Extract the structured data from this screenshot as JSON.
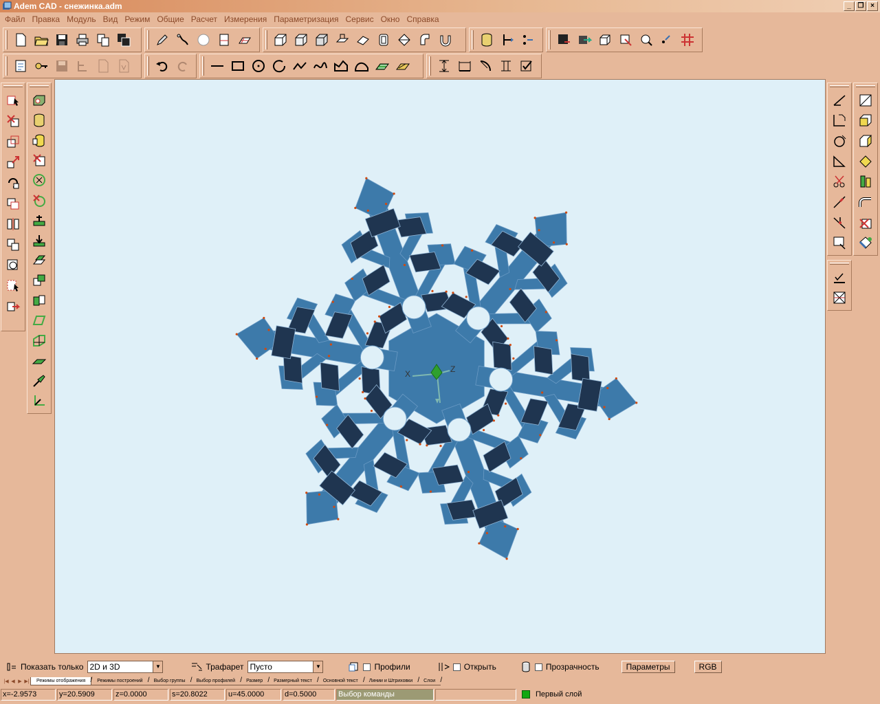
{
  "window": {
    "title": "Adem CAD - снежинка.adm",
    "controls": [
      "_",
      "❐",
      "×"
    ]
  },
  "menu": [
    "Файл",
    "Правка",
    "Модуль",
    "Вид",
    "Режим",
    "Общие",
    "Расчет",
    "Измерения",
    "Параметризация",
    "Сервис",
    "Окно",
    "Справка"
  ],
  "toolbars": {
    "top1": [
      "new-file-icon",
      "open-folder-icon",
      "save-icon",
      "print-icon",
      "copy-files-icon",
      "save-all-icon",
      "pencil-icon",
      "sweep-icon",
      "sphere-icon",
      "printer-plane-icon",
      "grid-plane-icon",
      "solid-box-icon",
      "solid-box2-icon",
      "solid-box3-icon",
      "extrude-icon",
      "plane-cut-icon",
      "shell-icon",
      "revolve-icon",
      "fillet-icon",
      "channel-icon",
      "cylinder-icon",
      "axis-left-icon",
      "axis-right-icon",
      "cad-save-icon",
      "cad-export-icon",
      "cube-icon",
      "cube-arrow-icon",
      "zoom-icon",
      "point-icon",
      "hatch-grid-icon"
    ],
    "top2": [
      "properties-icon",
      "keys-icon",
      "save-disabled-icon",
      "tree-disabled-icon",
      "page-disabled-icon",
      "page-v-disabled-icon",
      "undo-icon",
      "redo-icon",
      "line-icon",
      "rectangle-icon",
      "circle-icon",
      "arc-circle-icon",
      "polyline-icon",
      "spline-icon",
      "polygon-icon",
      "curve-icon",
      "hatch-icon",
      "hatch2-icon",
      "dim-vertical-icon",
      "dim-horizontal-icon",
      "dim-radius-icon",
      "dim-align-icon",
      "dim-check-icon"
    ],
    "left1": [
      "select-solid-icon",
      "delete-solid-icon",
      "copy-solid-icon",
      "move-solid-icon",
      "rotate-solid-icon",
      "clone-solid-icon",
      "mirror-solid-icon",
      "array-solid-icon",
      "scale-solid-icon",
      "select-frame-icon",
      "move-frame-icon"
    ],
    "left2": [
      "cut-solid-icon",
      "cylinder-add-icon",
      "cylinder-yellow-icon",
      "delete-red-icon",
      "circle-x-icon",
      "circle-x-red-icon",
      "plane-green-icon",
      "plane-green2-icon",
      "plane-stack-icon",
      "plane-stack2-icon",
      "plane-stack3-icon",
      "plane-outline-icon",
      "plane-grid-icon",
      "plane-flat-icon",
      "pin-icon",
      "axis-corner-icon"
    ],
    "right1": [
      "draw-angle-icon",
      "draw-corner-icon",
      "draw-circle-icon",
      "draw-triangle-icon",
      "scissors-icon",
      "pen-line-icon",
      "trim-icon",
      "annotate-icon"
    ],
    "right2": [
      "face-cut-icon",
      "face-yellow-icon",
      "face-yellow2-icon",
      "face-yellow3-icon",
      "face-green-icon",
      "pipe-icon",
      "face-delete-icon",
      "paint-icon"
    ],
    "right3": [
      "check-icon",
      "grid-check-icon"
    ]
  },
  "axes": {
    "x": "X",
    "z": "Z"
  },
  "options": {
    "show_only_label": "Показать только",
    "show_only_value": "2D и 3D",
    "stencil_label": "Трафарет",
    "stencil_value": "Пусто",
    "profiles_label": "Профили",
    "open_label": "Открыть",
    "transparency_label": "Прозрачность",
    "parameters_button": "Параметры",
    "rgb_button": "RGB"
  },
  "tabs": [
    "Режимы отображения",
    "Режимы построений",
    "Выбор группы",
    "Выбор профилей",
    "Размер",
    "Размерный текст",
    "Основной текст",
    "Линии и Штриховки",
    "Слои"
  ],
  "status": {
    "x": "x=-2.9573",
    "y": "y=20.5909",
    "z": "z=0.0000",
    "s": "s=20.8022",
    "u": "u=45.0000",
    "d": "d=0.5000",
    "command": "Выбор команды",
    "empty": "",
    "layer": "Первый слой"
  },
  "colors": {
    "snow_face": "#3d7aaa",
    "snow_side": "#1f3550",
    "vertex": "#d04a10",
    "axis_green": "#2fa02f"
  }
}
